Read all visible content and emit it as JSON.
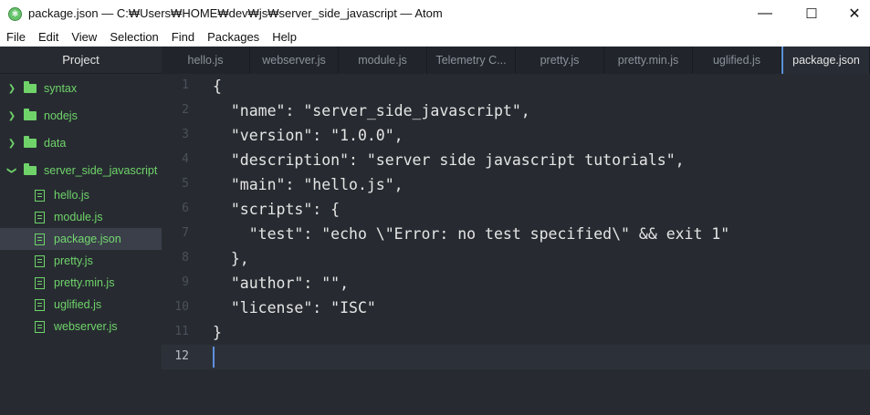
{
  "window": {
    "title": "package.json — C:₩Users₩HOME₩dev₩js₩server_side_javascript — Atom",
    "icon": "atom-app-icon",
    "controls": {
      "minimize": "—",
      "maximize": "☐",
      "close": "✕"
    }
  },
  "menu": [
    "File",
    "Edit",
    "View",
    "Selection",
    "Find",
    "Packages",
    "Help"
  ],
  "sidebar": {
    "title": "Project",
    "tree": [
      {
        "kind": "folder",
        "label": "syntax",
        "expanded": false
      },
      {
        "kind": "folder",
        "label": "nodejs",
        "expanded": false
      },
      {
        "kind": "folder",
        "label": "data",
        "expanded": false
      },
      {
        "kind": "folder",
        "label": "server_side_javascript",
        "expanded": true
      },
      {
        "kind": "file",
        "label": "hello.js"
      },
      {
        "kind": "file",
        "label": "module.js"
      },
      {
        "kind": "file",
        "label": "package.json",
        "selected": true
      },
      {
        "kind": "file",
        "label": "pretty.js"
      },
      {
        "kind": "file",
        "label": "pretty.min.js"
      },
      {
        "kind": "file",
        "label": "uglified.js"
      },
      {
        "kind": "file",
        "label": "webserver.js"
      }
    ]
  },
  "tabs": [
    {
      "label": "hello.js"
    },
    {
      "label": "webserver.js"
    },
    {
      "label": "module.js"
    },
    {
      "label": "Telemetry C..."
    },
    {
      "label": "pretty.js"
    },
    {
      "label": "pretty.min.js"
    },
    {
      "label": "uglified.js"
    },
    {
      "label": "package.json",
      "active": true
    }
  ],
  "editor": {
    "current_line": 12,
    "lines": [
      "{",
      "  \"name\": \"server_side_javascript\",",
      "  \"version\": \"1.0.0\",",
      "  \"description\": \"server side javascript tutorials\",",
      "  \"main\": \"hello.js\",",
      "  \"scripts\": {",
      "    \"test\": \"echo \\\"Error: no test specified\\\" && exit 1\"",
      "  },",
      "  \"author\": \"\",",
      "  \"license\": \"ISC\"",
      "}",
      ""
    ]
  },
  "colors": {
    "accent": "#5a8fd8",
    "sidebar_text": "#6fd36a",
    "editor_bg": "#272b31"
  }
}
